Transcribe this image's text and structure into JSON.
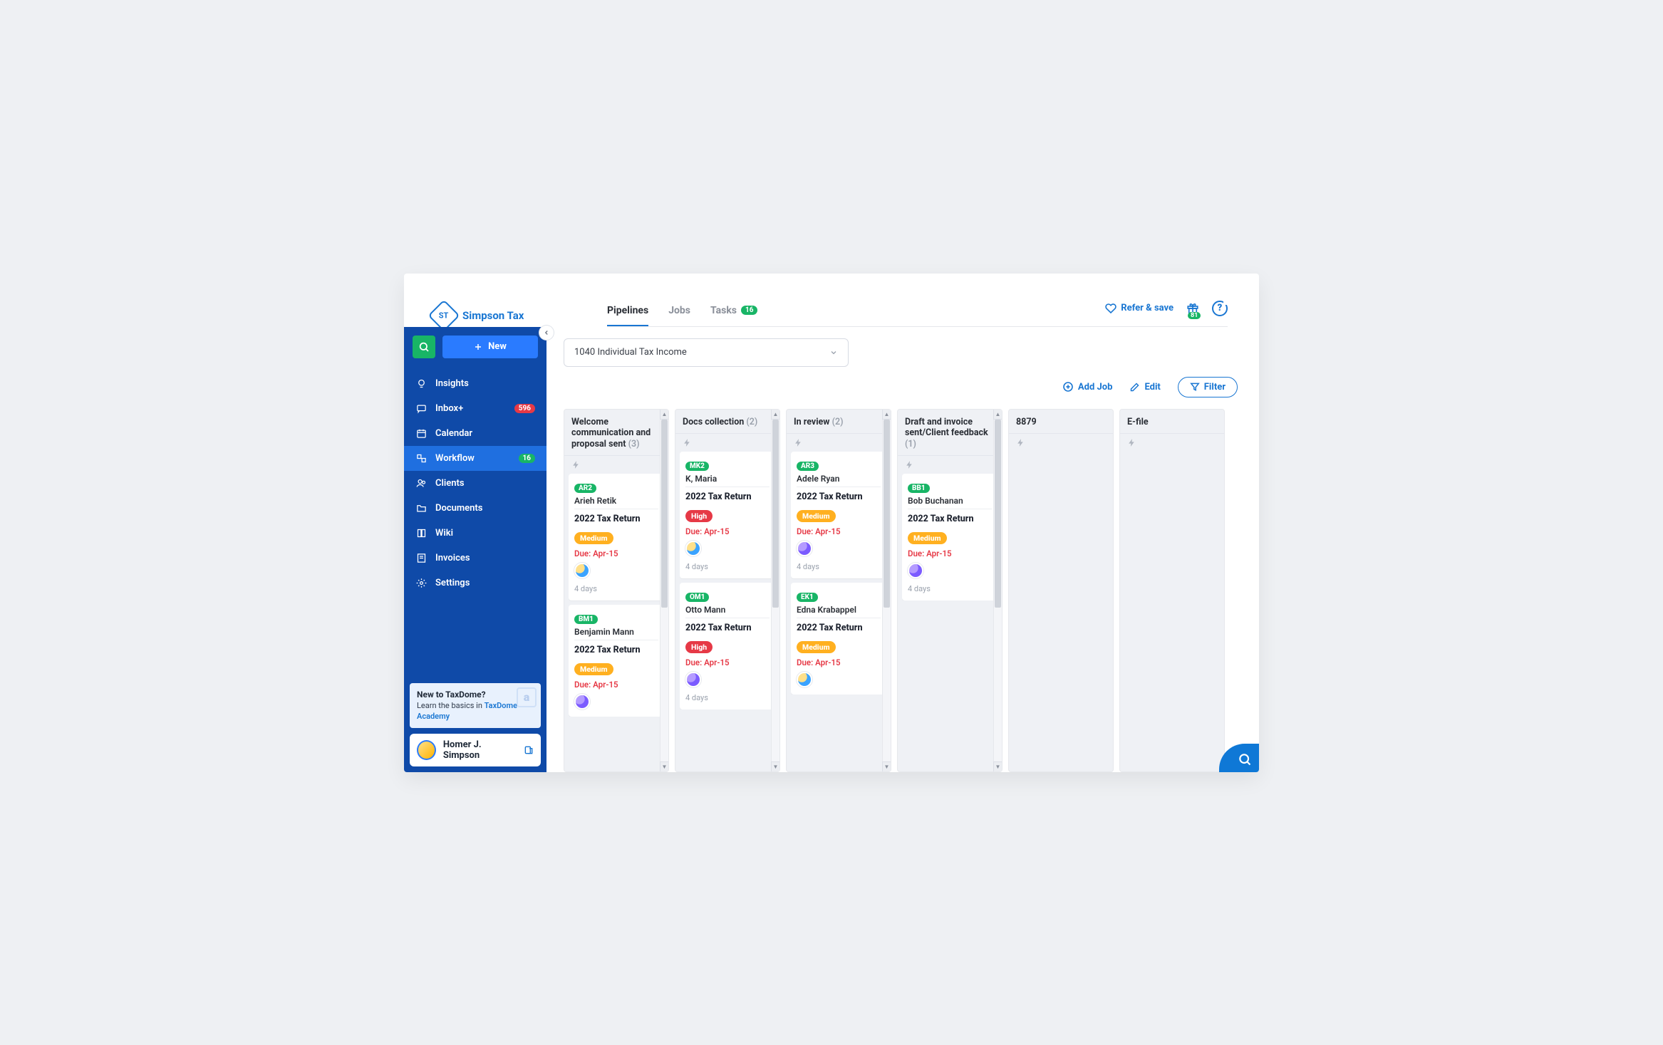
{
  "brand": {
    "abbr": "ST",
    "name": "Simpson Tax"
  },
  "tabs": {
    "pipelines": "Pipelines",
    "jobs": "Jobs",
    "tasks": "Tasks",
    "tasks_count": "16"
  },
  "header": {
    "refer": "Refer & save",
    "rewards_count": "81",
    "help": "?"
  },
  "sidebar": {
    "new_label": "New",
    "items": {
      "insights": "Insights",
      "inbox": "Inbox+",
      "inbox_badge": "596",
      "calendar": "Calendar",
      "workflow": "Workflow",
      "workflow_badge": "16",
      "clients": "Clients",
      "documents": "Documents",
      "wiki": "Wiki",
      "invoices": "Invoices",
      "settings": "Settings"
    },
    "academy": {
      "line1": "New to TaxDome?",
      "line2_a": "Learn the basics in ",
      "line2_b": "TaxDome Academy",
      "corner": "a"
    },
    "user": "Homer J. Simpson"
  },
  "pipeline_selector": "1040 Individual Tax Income",
  "actions": {
    "add": "Add Job",
    "edit": "Edit",
    "filter": "Filter"
  },
  "columns": [
    {
      "title": "Welcome communication and proposal sent",
      "count": "(3)",
      "cards": [
        {
          "tag": "AR2",
          "tag_color": "green",
          "client": "Arieh Retik",
          "title": "2022 Tax Return",
          "priority": "Medium",
          "priority_color": "medium",
          "due": "Due: Apr-15",
          "assignee": "homer",
          "age": "4 days"
        },
        {
          "tag": "BM1",
          "tag_color": "green",
          "client": "Benjamin Mann",
          "title": "2022 Tax Return",
          "priority": "Medium",
          "priority_color": "medium",
          "due": "Due: Apr-15",
          "assignee": "marge",
          "age": ""
        }
      ]
    },
    {
      "title": "Docs collection",
      "count": "(2)",
      "cards": [
        {
          "tag": "MK2",
          "tag_color": "green",
          "client": "K, Maria",
          "title": "2022 Tax Return",
          "priority": "High",
          "priority_color": "high",
          "due": "Due: Apr-15",
          "assignee": "homer",
          "age": "4 days"
        },
        {
          "tag": "OM1",
          "tag_color": "green",
          "client": "Otto Mann",
          "title": "2022 Tax Return",
          "priority": "High",
          "priority_color": "high",
          "due": "Due: Apr-15",
          "assignee": "marge",
          "age": "4 days"
        }
      ]
    },
    {
      "title": "In review",
      "count": "(2)",
      "cards": [
        {
          "tag": "AR3",
          "tag_color": "green",
          "client": "Adele Ryan",
          "title": "2022 Tax Return",
          "priority": "Medium",
          "priority_color": "medium",
          "due": "Due: Apr-15",
          "assignee": "marge",
          "age": "4 days"
        },
        {
          "tag": "EK1",
          "tag_color": "green",
          "client": "Edna Krabappel",
          "title": "2022 Tax Return",
          "priority": "Medium",
          "priority_color": "medium",
          "due": "Due: Apr-15",
          "assignee": "homer",
          "age": ""
        }
      ]
    },
    {
      "title": "Draft and invoice sent/Client feedback",
      "count": "(1)",
      "cards": [
        {
          "tag": "BB1",
          "tag_color": "green",
          "client": "Bob Buchanan",
          "title": "2022 Tax Return",
          "priority": "Medium",
          "priority_color": "medium",
          "due": "Due: Apr-15",
          "assignee": "marge",
          "age": "4 days"
        }
      ]
    },
    {
      "title": "8879",
      "count": "",
      "cards": []
    },
    {
      "title": "E-file",
      "count": "",
      "cards": []
    }
  ]
}
